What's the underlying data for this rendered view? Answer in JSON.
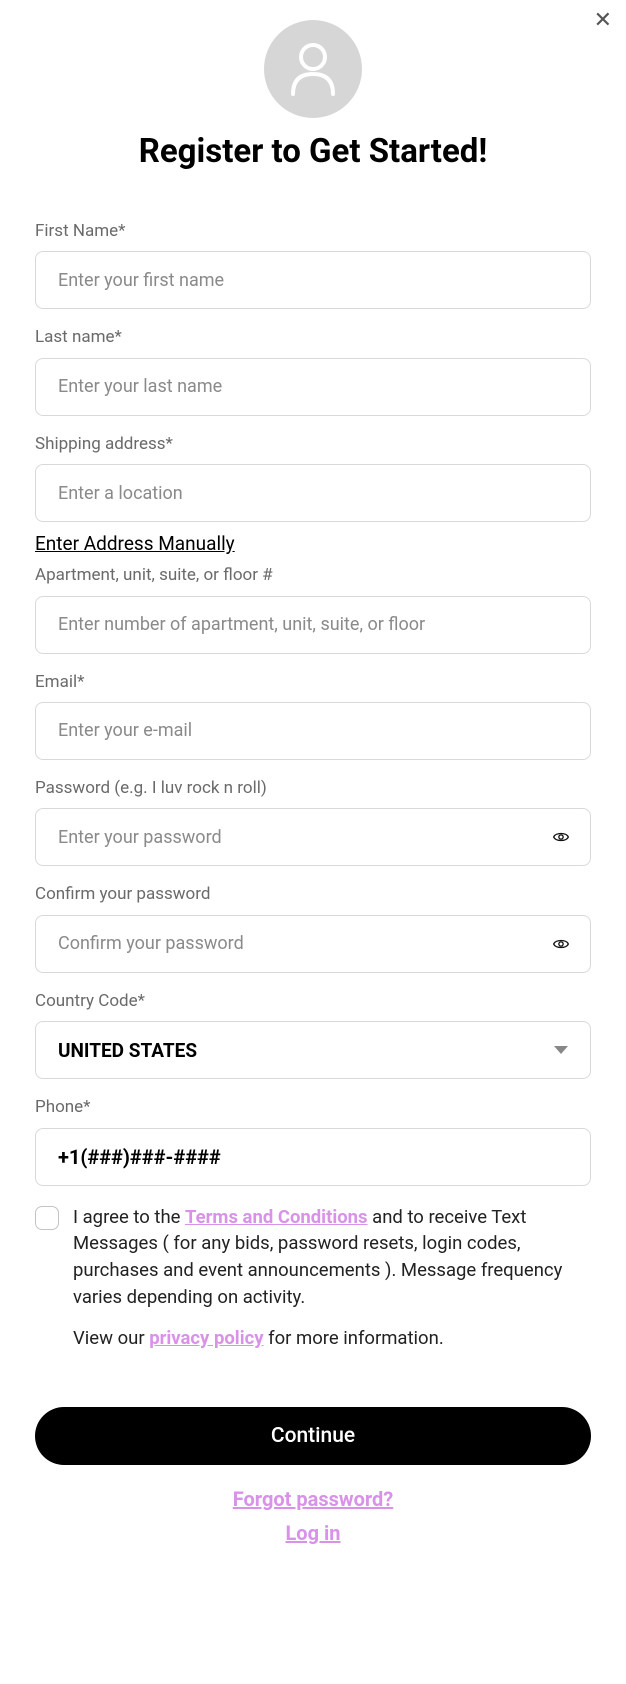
{
  "heading": "Register to Get Started!",
  "fields": {
    "firstName": {
      "label": "First Name*",
      "placeholder": "Enter your first name"
    },
    "lastName": {
      "label": "Last name*",
      "placeholder": "Enter your last name"
    },
    "shipping": {
      "label": "Shipping address*",
      "placeholder": "Enter a location",
      "manual": "Enter Address Manually"
    },
    "apartment": {
      "label": "Apartment, unit, suite, or floor #",
      "placeholder": "Enter number of apartment, unit, suite, or floor"
    },
    "email": {
      "label": "Email*",
      "placeholder": "Enter your e-mail"
    },
    "password": {
      "label": "Password (e.g. I luv rock n roll)",
      "placeholder": "Enter your password"
    },
    "confirm": {
      "label": "Confirm your password",
      "placeholder": "Confirm your password"
    },
    "country": {
      "label": "Country Code*",
      "value": "UNITED STATES"
    },
    "phone": {
      "label": "Phone*",
      "value": "+1(###)###-####"
    }
  },
  "consent": {
    "pre": "I agree to the ",
    "termsLink": "Terms and Conditions",
    "post": " and to receive Text Messages ( for any bids, password resets, login codes, purchases and event announcements ). Message frequency varies depending on activity."
  },
  "privacy": {
    "pre": "View our ",
    "link": "privacy policy",
    "post": " for more information."
  },
  "buttons": {
    "continue": "Continue",
    "forgot": "Forgot password?",
    "login": "Log in"
  }
}
